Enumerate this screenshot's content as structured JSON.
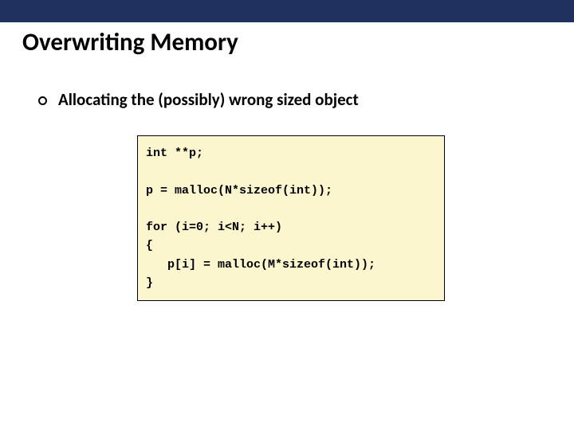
{
  "slide": {
    "title": "Overwriting Memory",
    "bullet": "Allocating the (possibly) wrong sized object",
    "code": "int **p;\n\np = malloc(N*sizeof(int));\n\nfor (i=0; i<N; i++)\n{\n   p[i] = malloc(M*sizeof(int));\n}"
  }
}
